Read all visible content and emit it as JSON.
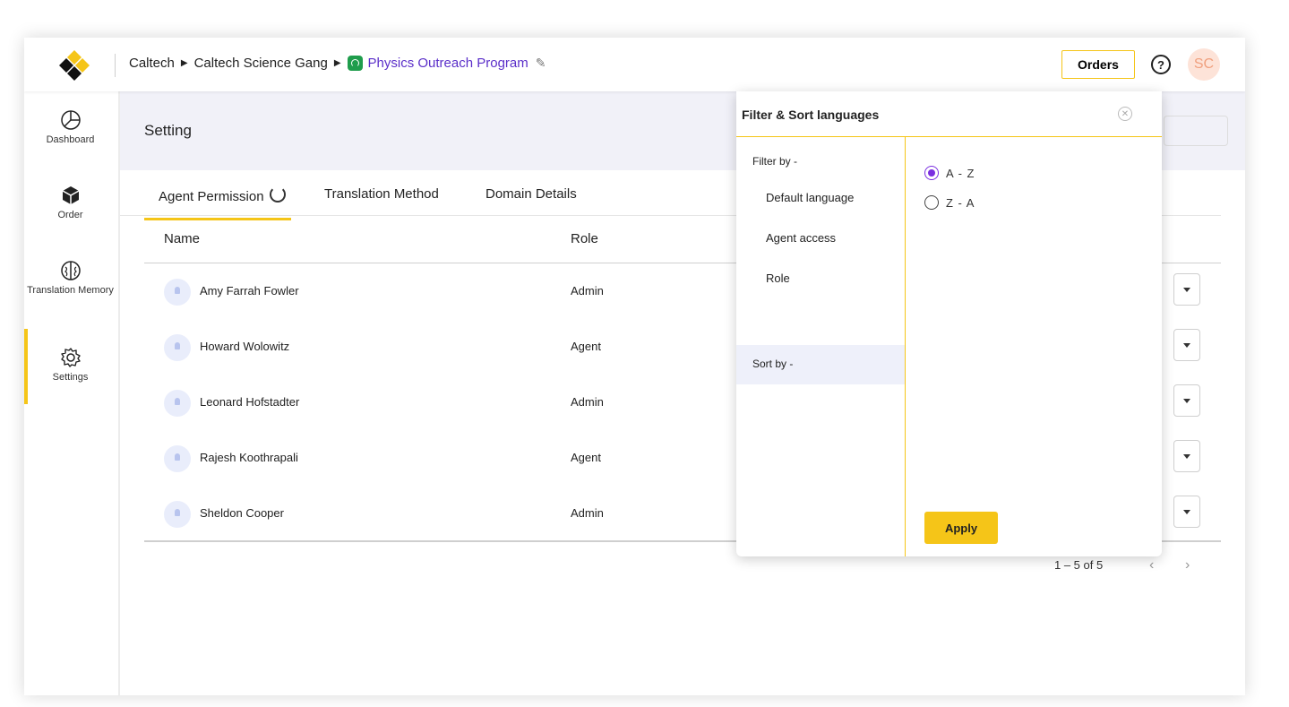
{
  "header": {
    "breadcrumb": [
      "Caltech",
      "Caltech Science Gang"
    ],
    "project": "Physics Outreach Program",
    "orders_label": "Orders",
    "help_label": "?",
    "avatar_initials": "SC"
  },
  "sidebar": {
    "items": [
      {
        "label": "Dashboard",
        "icon": "pie-chart-icon"
      },
      {
        "label": "Order",
        "icon": "box-icon"
      },
      {
        "label": "Translation Memory",
        "icon": "brain-icon"
      },
      {
        "label": "Settings",
        "icon": "gear-icon"
      }
    ],
    "active": "Settings"
  },
  "page": {
    "title": "Setting",
    "tabs": [
      "Agent Permission",
      "Translation Method",
      "Domain Details"
    ],
    "active_tab": "Agent Permission"
  },
  "table": {
    "columns": [
      "Name",
      "Role"
    ],
    "rows": [
      {
        "name": "Amy Farrah Fowler",
        "role": "Admin"
      },
      {
        "name": "Howard Wolowitz",
        "role": "Agent"
      },
      {
        "name": "Leonard Hofstadter",
        "role": "Admin"
      },
      {
        "name": "Rajesh Koothrapali",
        "role": "Agent"
      },
      {
        "name": "Sheldon Cooper",
        "role": "Admin"
      }
    ],
    "pagination": "1 – 5 of 5",
    "prev": "‹",
    "next": "›"
  },
  "filter_panel": {
    "title": "Filter & Sort languages",
    "filter_by_label": "Filter by -",
    "filter_items": [
      "Default language",
      "Agent access",
      "Role"
    ],
    "sort_by_label": "Sort by -",
    "sort_options": [
      {
        "label": "A - Z",
        "selected": true
      },
      {
        "label": "Z - A",
        "selected": false
      }
    ],
    "apply_label": "Apply"
  },
  "colors": {
    "accent": "#f5c518",
    "link": "#5b2fc9",
    "radio": "#7a2ee0"
  }
}
